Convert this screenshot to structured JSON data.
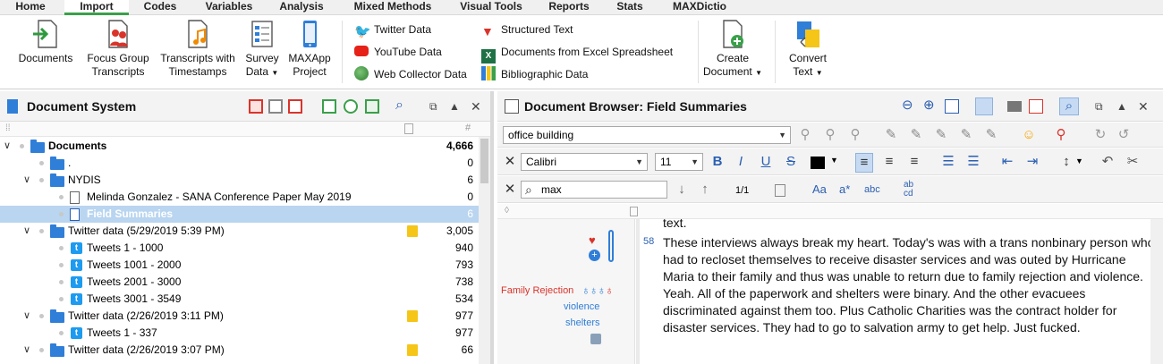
{
  "menu": [
    "Home",
    "Import",
    "Codes",
    "Variables",
    "Analysis",
    "Mixed Methods",
    "Visual Tools",
    "Reports",
    "Stats",
    "MAXDictio"
  ],
  "ribbon": {
    "documents": "Documents",
    "focus_group_1": "Focus Group",
    "focus_group_2": "Transcripts",
    "transcripts_ts_1": "Transcripts with",
    "transcripts_ts_2": "Timestamps",
    "survey_1": "Survey",
    "survey_2": "Data",
    "maxapp_1": "MAXApp",
    "maxapp_2": "Project",
    "twitter": "Twitter Data",
    "youtube": "YouTube Data",
    "webcollector": "Web Collector Data",
    "structured": "Structured Text",
    "excel": "Documents from Excel Spreadsheet",
    "biblio": "Bibliographic Data",
    "create_1": "Create",
    "create_2": "Document",
    "convert_1": "Convert",
    "convert_2": "Text"
  },
  "doc_system": {
    "title": "Document System",
    "rows": [
      {
        "label": "Documents",
        "count": "4,666"
      },
      {
        "label": ".",
        "count": "0"
      },
      {
        "label": "NYDIS",
        "count": "6"
      },
      {
        "label": "Melinda Gonzalez - SANA Conference Paper May 2019",
        "count": "0"
      },
      {
        "label": "Field Summaries",
        "count": "6"
      },
      {
        "label": "Twitter data (5/29/2019 5:39 PM)",
        "count": "3,005"
      },
      {
        "label": "Tweets 1 - 1000",
        "count": "940"
      },
      {
        "label": "Tweets 1001 - 2000",
        "count": "793"
      },
      {
        "label": "Tweets 2001 - 3000",
        "count": "738"
      },
      {
        "label": "Tweets 3001 - 3549",
        "count": "534"
      },
      {
        "label": "Twitter data (2/26/2019 3:11 PM)",
        "count": "977"
      },
      {
        "label": "Tweets 1 - 337",
        "count": "977"
      },
      {
        "label": "Twitter data (2/26/2019 3:07 PM)",
        "count": "66"
      }
    ]
  },
  "browser": {
    "title": "Document Browser: Field Summaries",
    "code_combo": "office building",
    "font": "Calibri",
    "size": "11",
    "search": "max",
    "hits": "1/1",
    "line_no": "58",
    "partial_line": "text.",
    "codes": [
      "Family Rejection",
      "violence",
      "shelters"
    ],
    "text": "These interviews always break my heart. Today's was with a trans nonbinary person who had to recloset themselves to receive disaster services and was outed by Hurricane Maria to their family and thus was unable to return due to family rejection and violence. Yeah. All of the paperwork and shelters were binary. And the other evacuees discriminated against them too. Plus Catholic Charities was the contract holder for disaster services. They had to go to salvation army to get help. Just fucked."
  },
  "colors": {
    "accent": "#3aa04a",
    "selection": "#b9d5f0",
    "folder": "#2f7ed8",
    "twitter": "#1d9bf0",
    "memo": "#f5c518",
    "code_red": "#d9342b"
  }
}
